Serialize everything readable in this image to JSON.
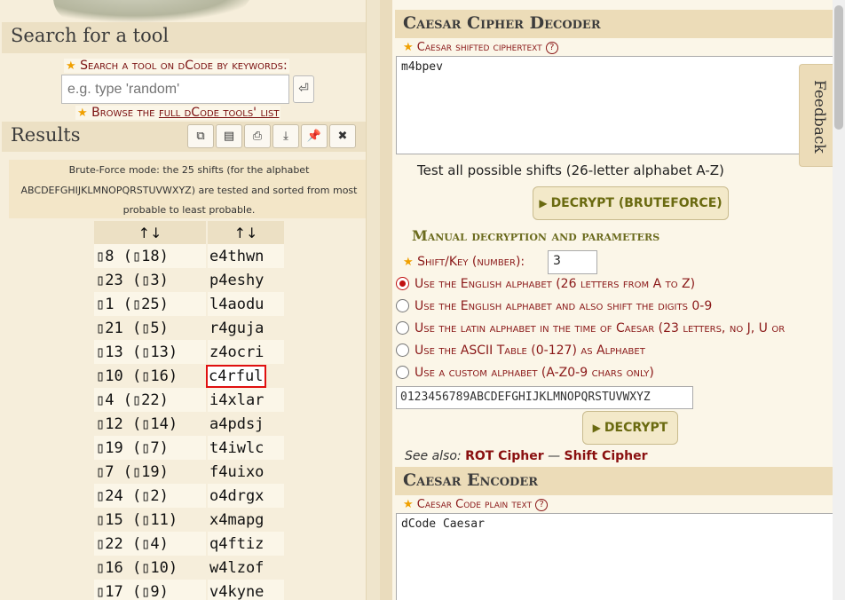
{
  "left": {
    "search_title": "Search for a tool",
    "search_caption": "Search a tool on dCode by keywords:",
    "search_placeholder": "e.g. type 'random'",
    "search_go_icon": "enter-arrow-icon",
    "browse_prefix": "Browse the",
    "browse_link": "full dCode tools' list",
    "results_title": "Results",
    "toolbar_icons": [
      "copy-icon",
      "paste-icon",
      "print-icon",
      "download-icon",
      "pin-icon",
      "close-icon"
    ],
    "bruteforce_note": "Brute-Force mode: the 25 shifts (for the alphabet ABCDEFGHIJKLMNOPQRSTUVWXYZ) are tested and sorted from most probable to least probable.",
    "table": {
      "headers": [
        "↑↓",
        "↑↓"
      ],
      "rows": [
        [
          "▯8 (▯18)",
          "e4thwn"
        ],
        [
          "▯23 (▯3)",
          "p4eshy"
        ],
        [
          "▯1 (▯25)",
          "l4aodu"
        ],
        [
          "▯21 (▯5)",
          "r4guja"
        ],
        [
          "▯13 (▯13)",
          "z4ocri"
        ],
        [
          "▯10 (▯16)",
          "c4rful"
        ],
        [
          "▯4 (▯22)",
          "i4xlar"
        ],
        [
          "▯12 (▯14)",
          "a4pdsj"
        ],
        [
          "▯19 (▯7)",
          "t4iwlc"
        ],
        [
          "▯7 (▯19)",
          "f4uixo"
        ],
        [
          "▯24 (▯2)",
          "o4drgx"
        ],
        [
          "▯15 (▯11)",
          "x4mapg"
        ],
        [
          "▯22 (▯4)",
          "q4ftiz"
        ],
        [
          "▯16 (▯10)",
          "w4lzof"
        ],
        [
          "▯17 (▯9)",
          "v4kyne"
        ]
      ]
    }
  },
  "right": {
    "decoder_title": "Caesar Cipher Decoder",
    "cipher_label": "Caesar shifted ciphertext",
    "help_glyph": "?",
    "cipher_value": "m4bpev",
    "feedback": "Feedback",
    "bruteforce_caption": "Test all possible shifts (26-letter alphabet A-Z)",
    "bruteforce_button": "DECRYPT (BRUTEFORCE)",
    "manual_title": "Manual decryption and parameters",
    "shift_label": "Shift/Key (number):",
    "shift_value": "3",
    "radios": [
      {
        "label": "Use the English alphabet (26 letters from A to Z)",
        "checked": true
      },
      {
        "label": "Use the English alphabet and also shift the digits 0-9",
        "checked": false
      },
      {
        "label": "Use the latin alphabet in the time of Caesar (23 letters, no J, U or",
        "checked": false
      },
      {
        "label": "Use the ASCII Table (0-127) as Alphabet",
        "checked": false
      },
      {
        "label": "Use a custom alphabet (A-Z0-9 chars only)",
        "checked": false
      }
    ],
    "custom_alphabet": "0123456789ABCDEFGHIJKLMNOPQRSTUVWXYZ",
    "decrypt_button": "DECRYPT",
    "see_also_label": "See also:",
    "see_also_link1": "ROT Cipher",
    "see_also_sep": " — ",
    "see_also_link2": "Shift Cipher",
    "encoder_title": "Caesar Encoder",
    "plain_label": "Caesar Code plain text",
    "plain_value": "dCode Caesar"
  },
  "colors": {
    "accent_red": "#8a1818",
    "highlight_border": "#e01010",
    "button_text": "#6a6a10",
    "panel_bg": "#ecdcb8"
  }
}
